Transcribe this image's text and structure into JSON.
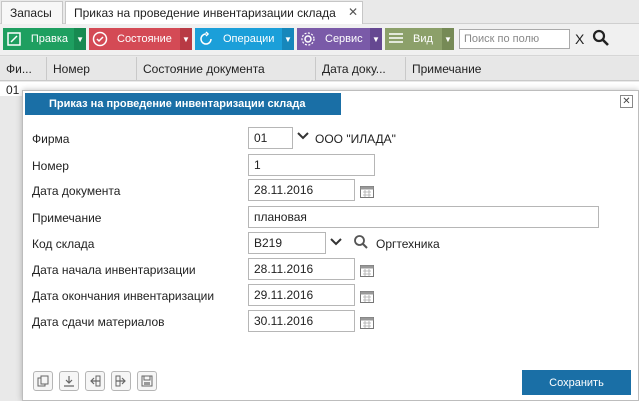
{
  "tabs": [
    {
      "label": "Запасы"
    },
    {
      "label": "Приказ на проведение инвентаризации склада",
      "close": "✕"
    }
  ],
  "toolbar": {
    "edit_label": "Правка",
    "state_label": "Состояние",
    "operations_label": "Операции",
    "service_label": "Сервис",
    "view_label": "Вид",
    "search_placeholder": "Поиск по полю",
    "clear_label": "X"
  },
  "grid": {
    "columns": [
      "Фи...",
      "Номер",
      "Состояние документа",
      "Дата доку...",
      "Примечание"
    ],
    "rows": [
      [
        "01"
      ]
    ]
  },
  "dialog": {
    "title": "Приказ на проведение инвентаризации склада",
    "fields": {
      "firm": {
        "label": "Фирма",
        "value": "01",
        "ref": "ООО \"ИЛАДА\""
      },
      "number": {
        "label": "Номер",
        "value": "1"
      },
      "doc_date": {
        "label": "Дата документа",
        "value": "28.11.2016"
      },
      "note": {
        "label": "Примечание",
        "value": "плановая"
      },
      "warehouse": {
        "label": "Код склада",
        "value": "В219",
        "ref": "Оргтехника"
      },
      "start_date": {
        "label": "Дата начала инвентаризации",
        "value": "28.11.2016"
      },
      "end_date": {
        "label": "Дата окончания инвентаризации",
        "value": "29.11.2016"
      },
      "handover_date": {
        "label": "Дата сдачи материалов",
        "value": "30.11.2016"
      }
    },
    "save_label": "Сохранить"
  },
  "colors": {
    "edit": "#1e9f60",
    "state": "#d44a55",
    "operations": "#1b9fd9",
    "service": "#7a5aa8",
    "view": "#8ca06a",
    "dialog_title": "#1a6fa6"
  },
  "icons": {
    "edit": "edit-icon",
    "state": "circle-check-icon",
    "operations": "refresh-icon",
    "service": "gear-icon",
    "view": "list-view-icon",
    "search": "search-icon",
    "calendar": "calendar-icon",
    "dropdown": "chevron-down-icon"
  }
}
